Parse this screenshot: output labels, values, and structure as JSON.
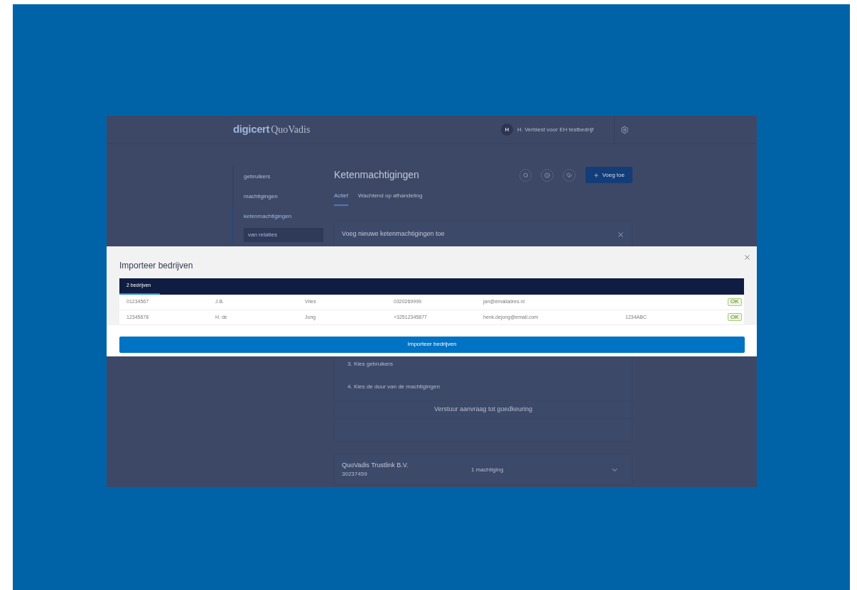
{
  "header": {
    "logo_text": "digicert",
    "logo_partner": "QuoVadis",
    "user_initial": "H",
    "user_name": "H. Verbiest voor EH testbedrijf"
  },
  "sidebar": {
    "items": [
      {
        "label": "gebruikers",
        "selected": false
      },
      {
        "label": "machtigingen",
        "selected": false
      },
      {
        "label": "ketenmachtigingen",
        "selected": true,
        "children": [
          {
            "label": "van relaties",
            "selected": true
          }
        ]
      }
    ]
  },
  "page": {
    "title": "Ketenmachtigingen",
    "add_button": "Voeg toe",
    "tabs": [
      {
        "label": "Actief",
        "selected": true
      },
      {
        "label": "Wachtend op afhandeling",
        "selected": false
      }
    ]
  },
  "card": {
    "title": "Voeg nieuwe ketenmachtigingen toe",
    "steps": [
      "3. Kies gebruikers",
      "4. Kies de duur van de machtigingen"
    ],
    "submit": "Verstuur aanvraag tot goedkeuring"
  },
  "relations": [
    {
      "name": "QuoVadis Trustlink B.V.",
      "number": "30237459",
      "count": "1 machtiging"
    }
  ],
  "modal": {
    "title": "Importeer bedrijven",
    "tabs": [
      {
        "label": "2 bedrijven",
        "selected": true
      }
    ],
    "rows": [
      {
        "cells": [
          "01234567",
          "J.B.",
          "Vries",
          "0320269999",
          "jan@emailadres.nl"
        ],
        "status": "OK"
      },
      {
        "cells": [
          "12345678",
          "H. de",
          "Jong",
          "+32512345877",
          "henk.dejong@email.com",
          "1234ABC"
        ],
        "status": "OK"
      }
    ],
    "button": "Importeer bedrijven"
  }
}
